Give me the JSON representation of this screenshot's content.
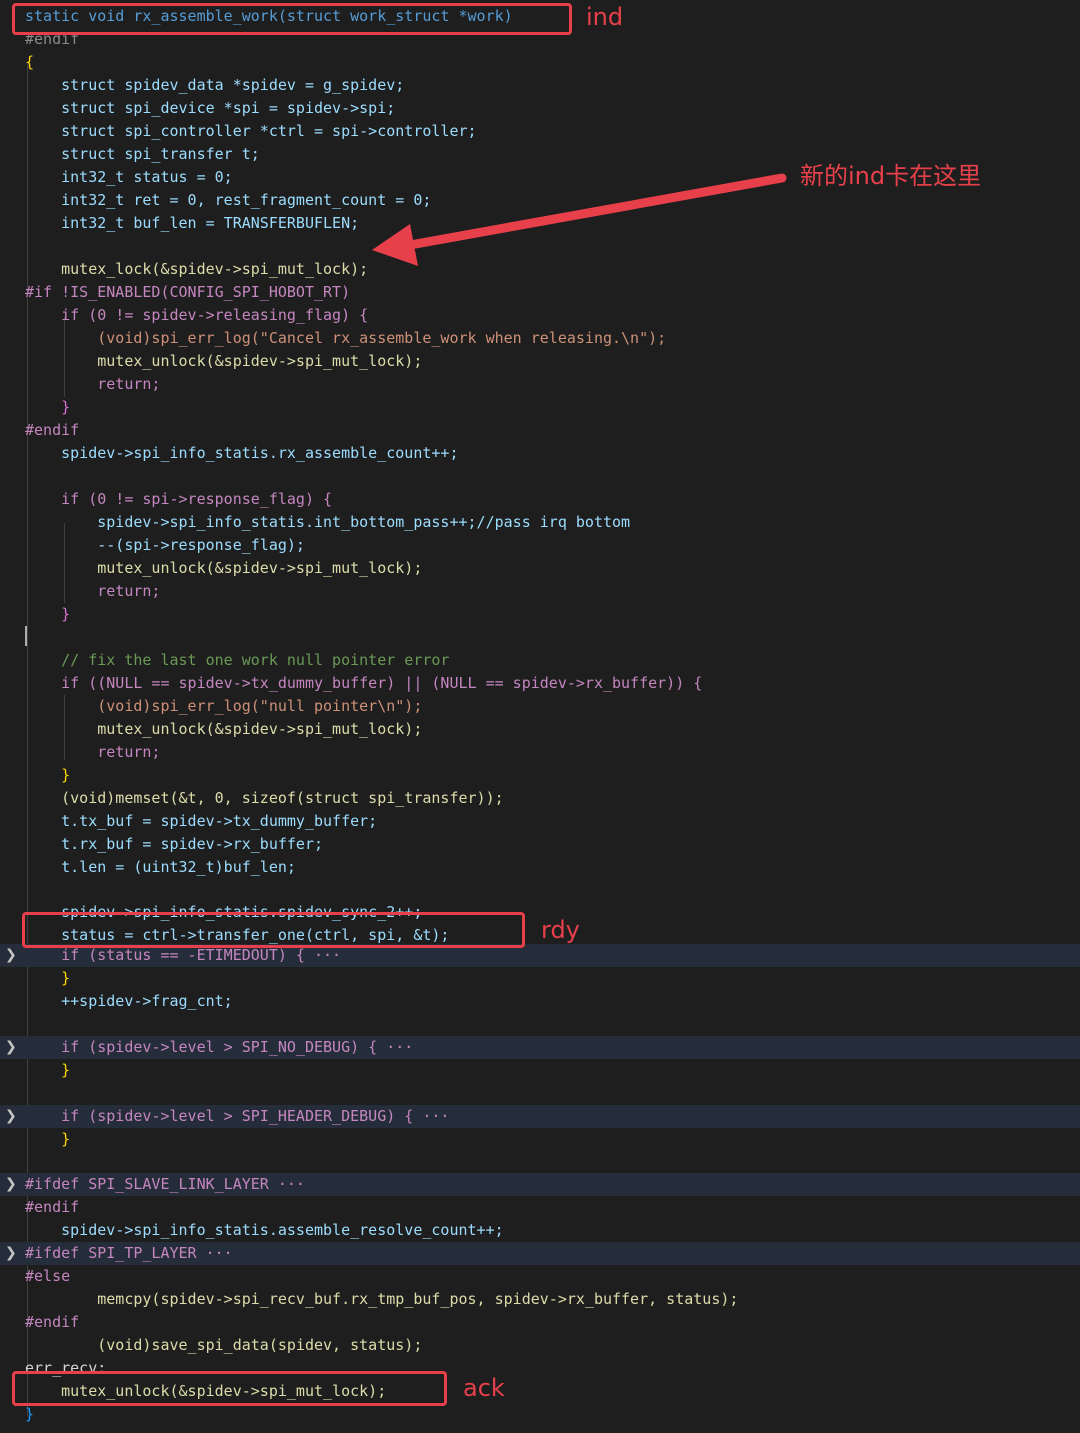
{
  "annotations": {
    "ind": "ind",
    "arrow_note": "新的ind卡在这里",
    "rdy": "rdy",
    "ack": "ack"
  },
  "code_lines": [
    "static void rx_assemble_work(struct work_struct *work)",
    "#endif",
    "{",
    "    struct spidev_data *spidev = g_spidev;",
    "    struct spi_device *spi = spidev->spi;",
    "    struct spi_controller *ctrl = spi->controller;",
    "    struct spi_transfer t;",
    "    int32_t status = 0;",
    "    int32_t ret = 0, rest_fragment_count = 0;",
    "    int32_t buf_len = TRANSFERBUFLEN;",
    "",
    "    mutex_lock(&spidev->spi_mut_lock);",
    "#if !IS_ENABLED(CONFIG_SPI_HOBOT_RT)",
    "    if (0 != spidev->releasing_flag) {",
    "        (void)spi_err_log(\"Cancel rx_assemble_work when releasing.\\n\");",
    "        mutex_unlock(&spidev->spi_mut_lock);",
    "        return;",
    "    }",
    "#endif",
    "    spidev->spi_info_statis.rx_assemble_count++;",
    "",
    "    if (0 != spi->response_flag) {",
    "        spidev->spi_info_statis.int_bottom_pass++;//pass irq bottom",
    "        --(spi->response_flag);",
    "        mutex_unlock(&spidev->spi_mut_lock);",
    "        return;",
    "    }",
    "",
    "    // fix the last one work null pointer error",
    "    if ((NULL == spidev->tx_dummy_buffer) || (NULL == spidev->rx_buffer)) {",
    "        (void)spi_err_log(\"null pointer\\n\");",
    "        mutex_unlock(&spidev->spi_mut_lock);",
    "        return;",
    "    }",
    "    (void)memset(&t, 0, sizeof(struct spi_transfer));",
    "    t.tx_buf = spidev->tx_dummy_buffer;",
    "    t.rx_buf = spidev->rx_buffer;",
    "    t.len = (uint32_t)buf_len;",
    "",
    "    spidev->spi_info_statis.spidev_sync_2++;",
    "    status = ctrl->transfer_one(ctrl, spi, &t);",
    "    if (status == -ETIMEDOUT) { ···",
    "    }",
    "    ++spidev->frag_cnt;",
    "",
    "    if (spidev->level > SPI_NO_DEBUG) { ···",
    "    }",
    "",
    "    if (spidev->level > SPI_HEADER_DEBUG) { ···",
    "    }",
    "",
    "#ifdef SPI_SLAVE_LINK_LAYER ···",
    "#endif",
    "    spidev->spi_info_statis.assemble_resolve_count++;",
    "#ifdef SPI_TP_LAYER ···",
    "#else",
    "        memcpy(spidev->spi_recv_buf.rx_tmp_buf_pos, spidev->rx_buffer, status);",
    "#endif",
    "        (void)save_spi_data(spidev, status);",
    "err_recv:",
    "    mutex_unlock(&spidev->spi_mut_lock);",
    "}"
  ]
}
